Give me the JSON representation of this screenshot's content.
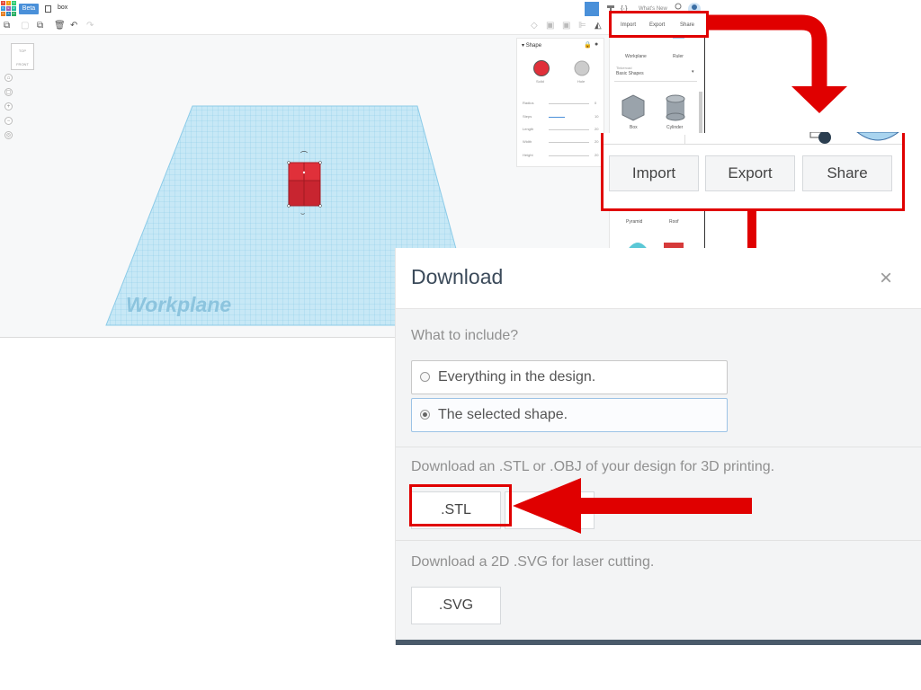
{
  "app": {
    "beta_label": "Beta",
    "doc_name": "box",
    "whats_new": "What's New",
    "top_actions": [
      "Import",
      "Export",
      "Share"
    ],
    "viewcube": {
      "top": "TOP",
      "front": "FRONT"
    },
    "workplane_label": "Workplane"
  },
  "shape_panel": {
    "title": "Shape",
    "solid_label": "Solid",
    "hole_label": "Hole",
    "rows": [
      {
        "label": "Radius",
        "value": "0"
      },
      {
        "label": "Steps",
        "value": "10"
      },
      {
        "label": "Length",
        "value": "20"
      },
      {
        "label": "Width",
        "value": "20"
      },
      {
        "label": "Height",
        "value": "20"
      }
    ]
  },
  "sidebar": {
    "workplane": "Workplane",
    "ruler": "Ruler",
    "library_title": "Tinkercad",
    "library_value": "Basic Shapes",
    "shape_box": "Box",
    "shape_cylinder": "Cylinder",
    "shape_pyramid": "Pyramid",
    "shape_roof": "Roof"
  },
  "callout": {
    "import": "Import",
    "export": "Export",
    "share": "Share"
  },
  "dialog": {
    "title": "Download",
    "include_label": "What to include?",
    "option_everything": "Everything in the design.",
    "option_selected": "The selected shape.",
    "selected_option": "selected",
    "stl_text": "Download an .STL or .OBJ of your design for 3D printing.",
    "stl_button": ".STL",
    "svg_text": "Download a 2D .SVG for laser cutting.",
    "svg_button": ".SVG"
  },
  "colors": {
    "annotation_red": "#e00000",
    "accent_blue": "#4a90d9",
    "workplane_blue": "#a8daf0",
    "shape_red": "#e0303a"
  }
}
